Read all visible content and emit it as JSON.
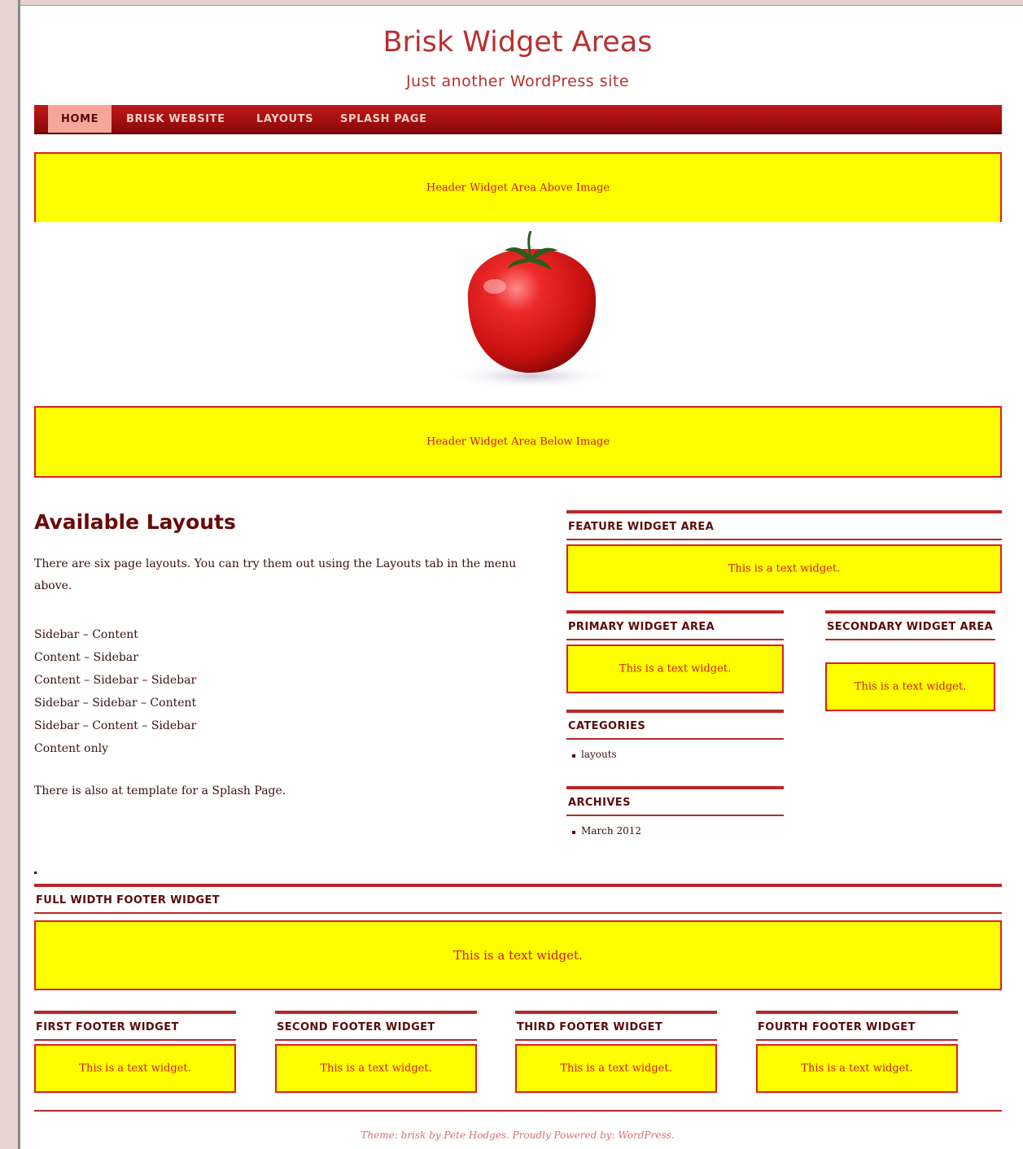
{
  "site": {
    "title": "Brisk Widget Areas",
    "tagline": "Just another WordPress site"
  },
  "nav": {
    "items": [
      {
        "label": "HOME",
        "active": true
      },
      {
        "label": "BRISK WEBSITE",
        "active": false
      },
      {
        "label": "LAYOUTS",
        "active": false
      },
      {
        "label": "SPLASH PAGE",
        "active": false
      }
    ]
  },
  "header_widgets": {
    "above_image": "Header Widget Area Above Image",
    "below_image": "Header Widget Area Below Image"
  },
  "main": {
    "title": "Available Layouts",
    "intro": "There are six page layouts. You can try them out using the Layouts tab in the menu above.",
    "layouts": [
      "Sidebar – Content",
      "Content – Sidebar",
      "Content – Sidebar – Sidebar",
      "Sidebar – Sidebar – Content",
      "Sidebar – Content – Sidebar",
      "Content only"
    ],
    "splash_note": "There is also at template for a Splash Page."
  },
  "sidebar": {
    "feature": {
      "title": "FEATURE WIDGET AREA",
      "text": "This is a text widget."
    },
    "primary": {
      "title": "PRIMARY WIDGET AREA",
      "text": "This is a text widget."
    },
    "secondary": {
      "title": "SECONDARY WIDGET AREA",
      "text": "This is a text widget."
    },
    "categories": {
      "title": "CATEGORIES",
      "items": [
        "layouts"
      ]
    },
    "archives": {
      "title": "ARCHIVES",
      "items": [
        "March 2012"
      ]
    }
  },
  "footer": {
    "full_width": {
      "title": "FULL WIDTH FOOTER WIDGET",
      "text": "This is a text widget."
    },
    "first": {
      "title": "FIRST FOOTER WIDGET",
      "text": "This is a text widget."
    },
    "second": {
      "title": "SECOND FOOTER WIDGET",
      "text": "This is a text widget."
    },
    "third": {
      "title": "THIRD FOOTER WIDGET",
      "text": "This is a text widget."
    },
    "fourth": {
      "title": "FOURTH FOOTER WIDGET",
      "text": "This is a text widget."
    },
    "credits": "Theme: brisk by Pete Hodges. Proudly Powered by: WordPress."
  },
  "colors": {
    "accent": "#b82828",
    "nav_active": "#f7a79a",
    "widget_bg": "#ffff00",
    "widget_text": "#d01818"
  },
  "image": {
    "icon": "tomato-image"
  }
}
